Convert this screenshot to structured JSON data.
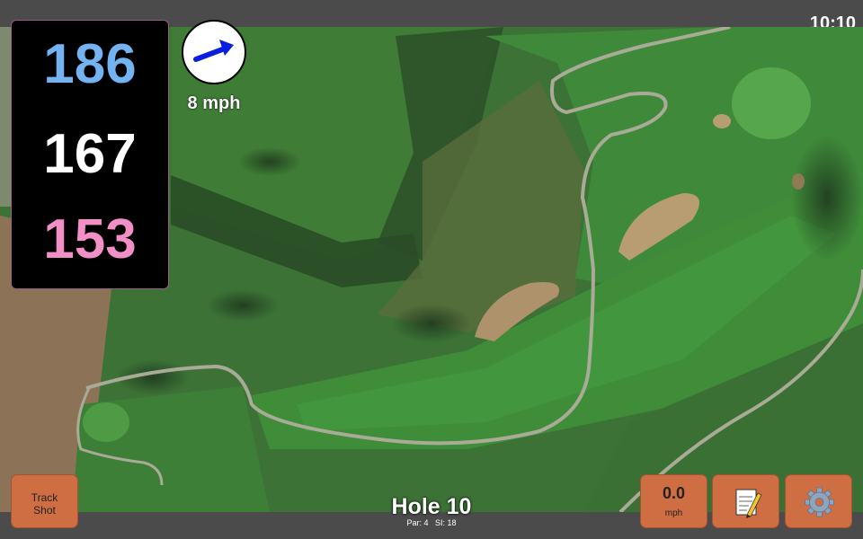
{
  "status": {
    "time": "10:10"
  },
  "distances": {
    "back": "186",
    "middle": "167",
    "front": "153"
  },
  "colors": {
    "back": "#74b3f2",
    "middle": "#ffffff",
    "front": "#f18fc6",
    "button": "#cf6e43"
  },
  "wind": {
    "speed": "8 mph",
    "direction_icon": "wind-arrow-icon"
  },
  "buttons": {
    "track_shot": "Track\nShot",
    "speed_value": "0.0",
    "speed_unit": "mph",
    "notes_icon": "notepad-icon",
    "settings_icon": "gear-icon"
  },
  "hole": {
    "title": "Hole 10",
    "par": "Par: 4",
    "si": "SI: 18"
  }
}
